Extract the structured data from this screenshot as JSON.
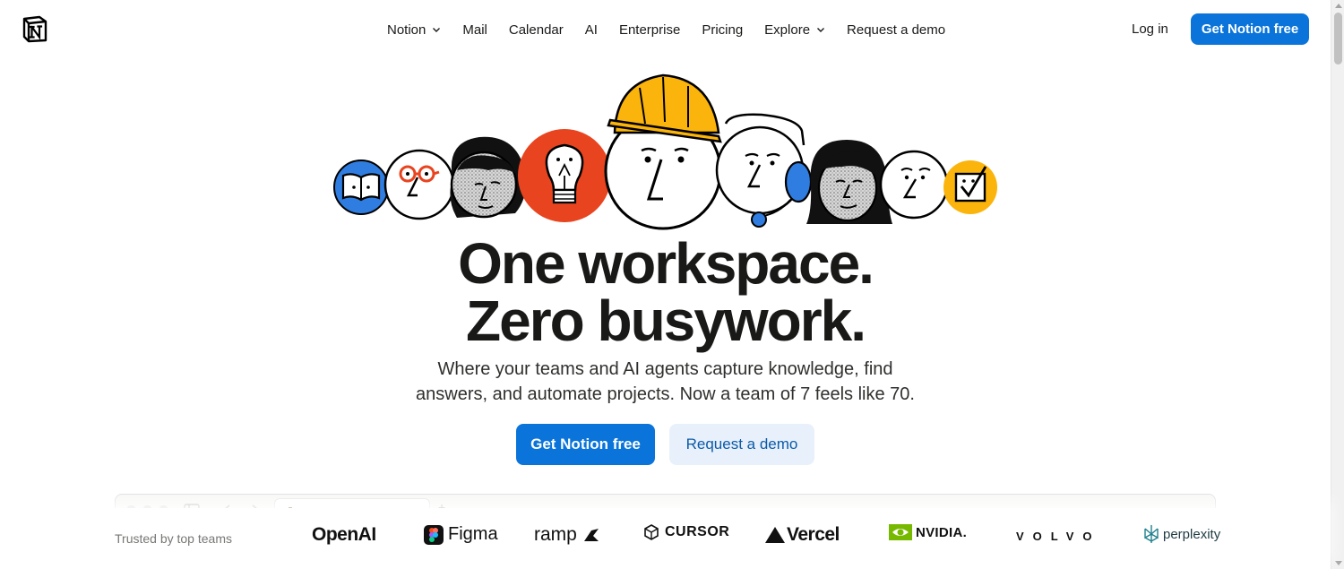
{
  "header": {
    "logo_icon": "notion-logo-icon",
    "nav": [
      {
        "label": "Notion",
        "dropdown": true
      },
      {
        "label": "Mail",
        "dropdown": false
      },
      {
        "label": "Calendar",
        "dropdown": false
      },
      {
        "label": "AI",
        "dropdown": false
      },
      {
        "label": "Enterprise",
        "dropdown": false
      },
      {
        "label": "Pricing",
        "dropdown": false
      },
      {
        "label": "Explore",
        "dropdown": true
      },
      {
        "label": "Request a demo",
        "dropdown": false
      }
    ],
    "login_label": "Log in",
    "cta_label": "Get Notion free"
  },
  "hero": {
    "headline_line1": "One workspace.",
    "headline_line2": "Zero busywork.",
    "subhead_line1": "Where your teams and AI agents capture knowledge, find",
    "subhead_line2": "answers, and automate projects. Now a team of 7 feels like 70.",
    "primary_cta": "Get Notion free",
    "secondary_cta": "Request a demo",
    "illustration_icons": [
      "book-icon",
      "glasses-face-icon",
      "curly-hair-face-icon",
      "lightbulb-icon",
      "hard-hat-face-icon",
      "headset-face-icon",
      "long-hair-face-icon",
      "plain-face-icon",
      "checkbox-icon"
    ]
  },
  "logos": {
    "trusted_label": "Trusted by top teams",
    "brands": [
      "OpenAI",
      "Figma",
      "ramp",
      "CURSOR",
      "Vercel",
      "NVIDIA.",
      "VOLVO",
      "perplexity"
    ]
  },
  "colors": {
    "accent": "#0a74da",
    "accent_light": "#e8f1fb",
    "illustration_blue": "#2f7de1",
    "illustration_red": "#e8441f",
    "illustration_yellow": "#fbb40c",
    "nvidia_green": "#76b900"
  }
}
